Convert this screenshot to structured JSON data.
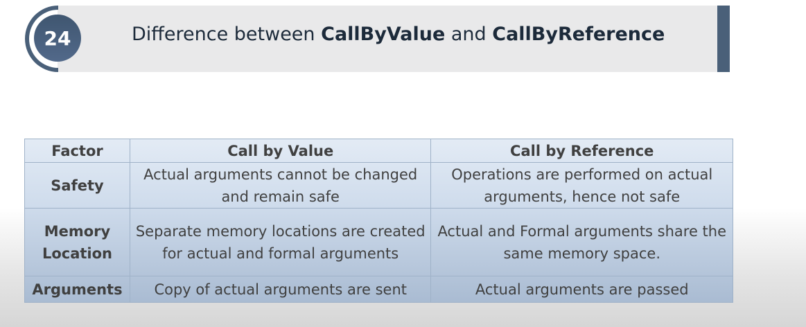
{
  "slide": {
    "number": "24",
    "title_prefix": "Difference between ",
    "title_term1": "CallByValue",
    "title_mid": " and ",
    "title_term2": "CallByReference"
  },
  "table": {
    "headers": [
      "Factor",
      "Call by Value",
      "Call by Reference"
    ],
    "rows": [
      {
        "factor": "Safety",
        "value": "Actual arguments cannot be changed and remain safe",
        "reference": "Operations are performed on actual arguments, hence not safe"
      },
      {
        "factor": "Memory Location",
        "value": "Separate memory locations are created for actual and formal arguments",
        "reference": "Actual and Formal arguments share the same memory space."
      },
      {
        "factor": "Arguments",
        "value": "Copy of actual arguments are sent",
        "reference": "Actual arguments are passed"
      }
    ]
  },
  "colors": {
    "accent": "#4a6079",
    "header_bg": "#e9e9ea"
  }
}
